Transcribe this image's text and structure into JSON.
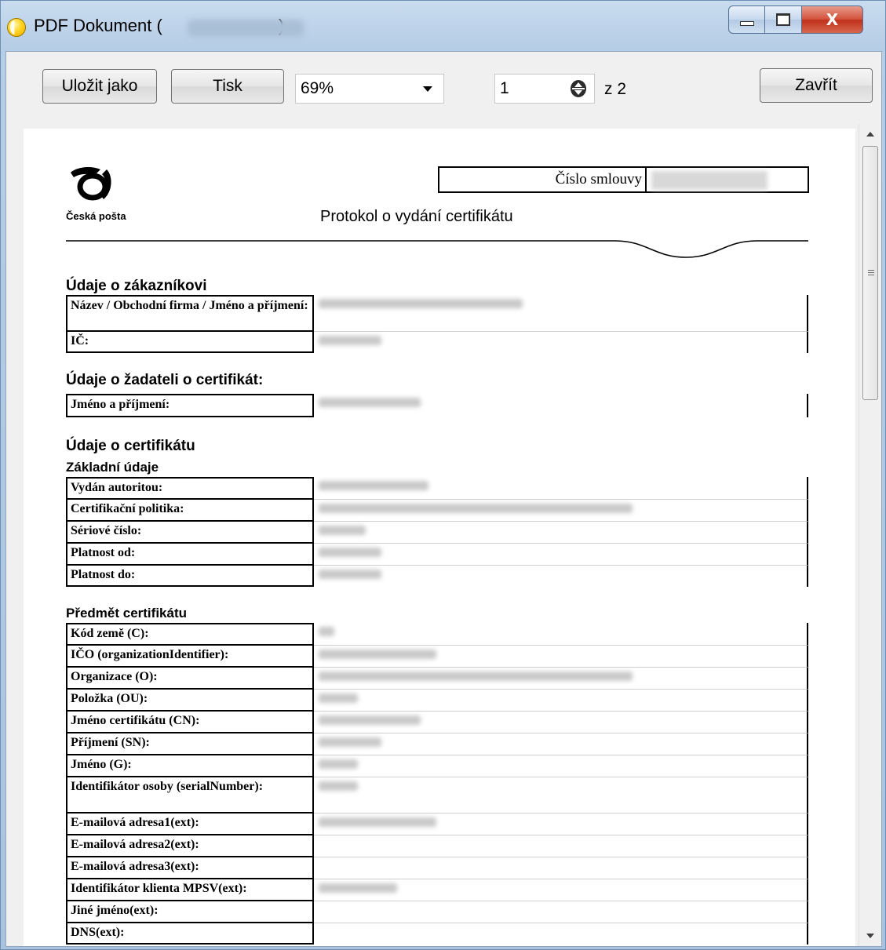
{
  "window": {
    "title": "PDF Dokument (",
    "title_suffix": ")",
    "minimize_label": "",
    "maximize_label": "",
    "close_glyph": "X"
  },
  "toolbar": {
    "save_as_label": "Uložit jako",
    "print_label": "Tisk",
    "zoom_value": "69%",
    "page_value": "1",
    "page_of_label": "z 2",
    "close_label": "Zavřít"
  },
  "document": {
    "logo_text": "Česká pošta",
    "contract_label": "Číslo smlouvy",
    "title": "Protokol o vydání certifikátu",
    "customer_section": {
      "heading": "Údaje o zákazníkovi",
      "rows": [
        {
          "label": "Název / Obchodní firma / Jméno a příjmení:"
        },
        {
          "label": "IČ:"
        }
      ]
    },
    "applicant_section": {
      "heading": "Údaje o žadateli o certifikát:",
      "rows": [
        {
          "label": "Jméno a příjmení:"
        }
      ]
    },
    "certificate_section": {
      "heading": "Údaje o certifikátu",
      "basic_heading": "Základní údaje",
      "basic_rows": [
        {
          "label": "Vydán autoritou:"
        },
        {
          "label": "Certifikační politika:"
        },
        {
          "label": "Sériové číslo:"
        },
        {
          "label": "Platnost od:"
        },
        {
          "label": "Platnost do:"
        }
      ],
      "subject_heading": "Předmět certifikátu",
      "subject_rows": [
        {
          "label": "Kód země (C):"
        },
        {
          "label": "IČO (organizationIdentifier):"
        },
        {
          "label": "Organizace (O):"
        },
        {
          "label": "Položka (OU):"
        },
        {
          "label": "Jméno certifikátu (CN):"
        },
        {
          "label": "Příjmení (SN):"
        },
        {
          "label": "Jméno (G):"
        },
        {
          "label": "Identifikátor osoby (serialNumber):"
        },
        {
          "label": "E-mailová adresa1(ext):"
        },
        {
          "label": "E-mailová adresa2(ext):"
        },
        {
          "label": "E-mailová adresa3(ext):"
        },
        {
          "label": "Identifikátor klienta MPSV(ext):"
        },
        {
          "label": "Jiné jméno(ext):"
        },
        {
          "label": "DNS(ext):"
        }
      ]
    }
  },
  "colors": {
    "window_frame": "#b9d1ea",
    "close_button": "#c9432c",
    "page_background": "#ffffff"
  }
}
